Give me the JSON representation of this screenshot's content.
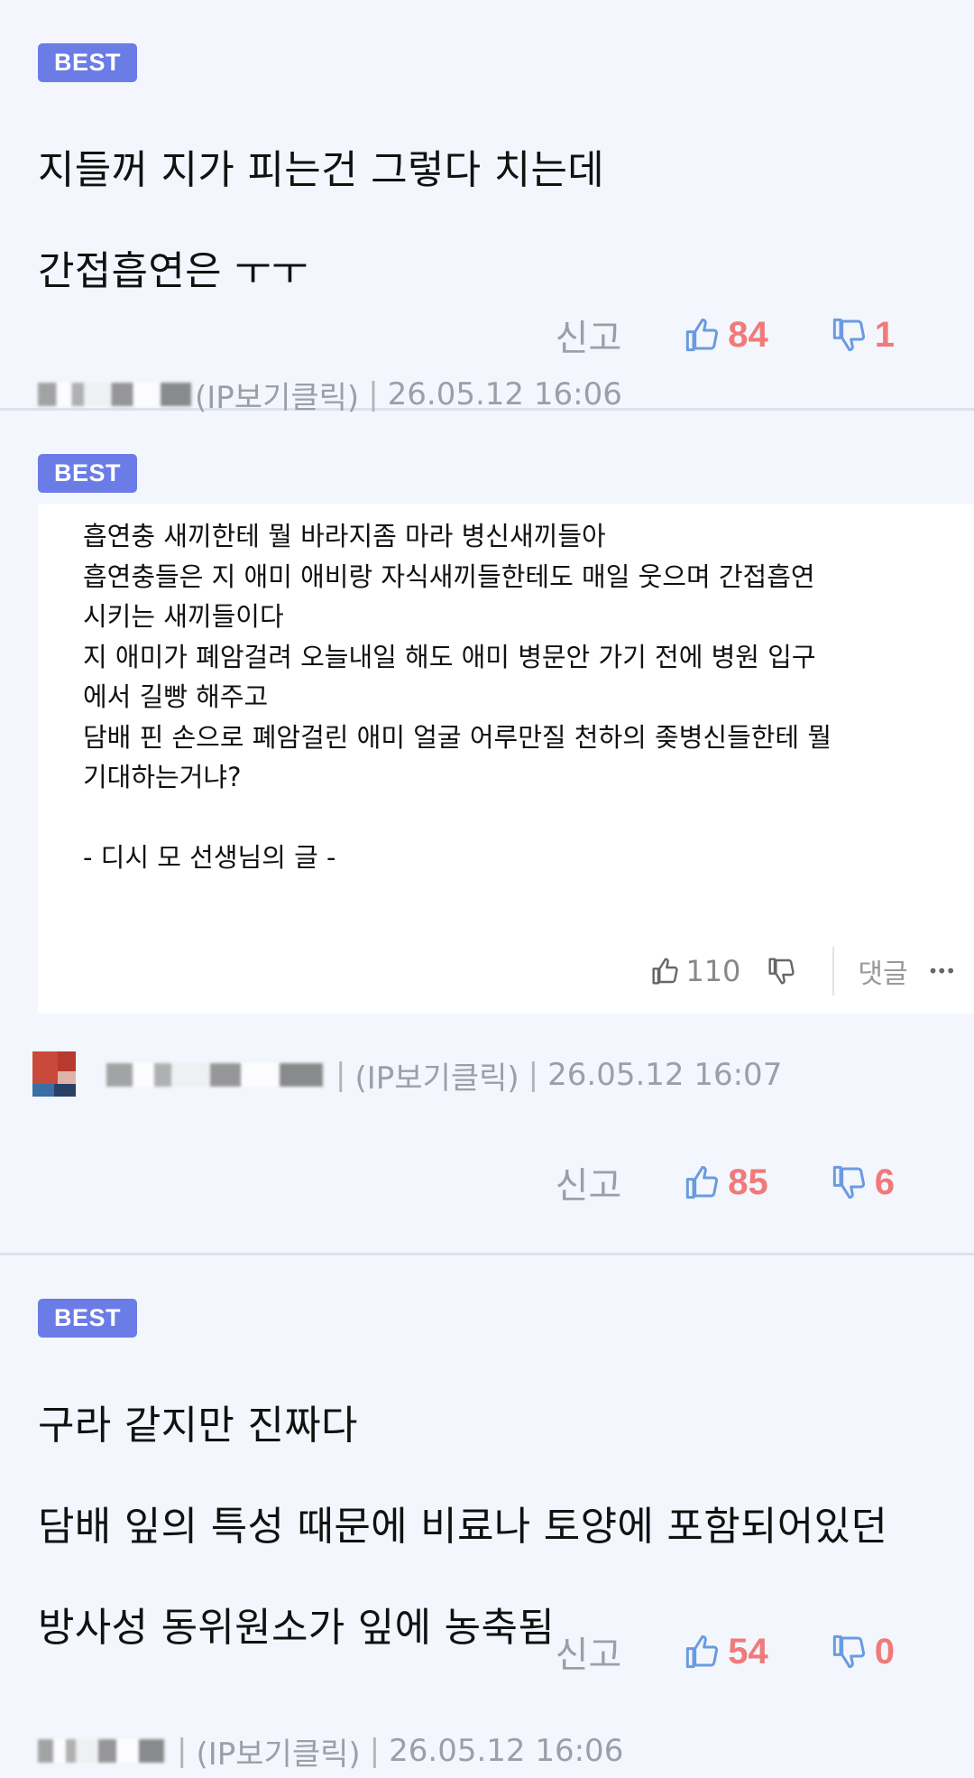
{
  "comments": [
    {
      "badge": "BEST",
      "lines": [
        "지들꺼 지가 피는건 그렇다 치는데",
        "간접흡연은 ㅜㅜ"
      ],
      "meta_ip": "(IP보기클릭)",
      "meta_sep": "|",
      "meta_date": "26.05.12 16:06",
      "report": "신고",
      "likes": "84",
      "dislikes": "1"
    },
    {
      "badge": "BEST",
      "embed": {
        "lines": [
          "흡연충 새끼한테 뭘 바라지좀 마라 병신새끼들아",
          "흡연충들은 지 애미 애비랑 자식새끼들한테도 매일 웃으며 간접흡연",
          "시키는 새끼들이다",
          "지 애미가 폐암걸려 오늘내일 해도 애미 병문안 가기 전에 병원 입구",
          "에서 길빵 해주고",
          "담배 핀 손으로 폐암걸린 애미 얼굴 어루만질 천하의 좆병신들한테 뭘",
          "기대하는거냐?",
          "",
          "- 디시 모 선생님의 글 -"
        ],
        "likes": "110",
        "reply": "댓글",
        "more": "•••"
      },
      "meta_ip": "(IP보기클릭)",
      "meta_sep": "|",
      "meta_date": "26.05.12 16:07",
      "report": "신고",
      "likes": "85",
      "dislikes": "6"
    },
    {
      "badge": "BEST",
      "lines": [
        "구라 같지만 진짜다",
        "담배 잎의 특성 때문에 비료나 토양에 포함되어있던",
        "방사성 동위원소가 잎에 농축됨"
      ],
      "meta_ip": "(IP보기클릭)",
      "meta_sep": "|",
      "meta_date": "26.05.12 16:06",
      "report": "신고",
      "likes": "54",
      "dislikes": "0"
    }
  ],
  "colors": {
    "badge": "#6b7ce6",
    "count": "#f07a7a",
    "thumb": "#6a9be0",
    "background": "#f3f6fc"
  },
  "icons": {
    "like": "thumbs-up-icon",
    "dislike": "thumbs-down-icon"
  }
}
